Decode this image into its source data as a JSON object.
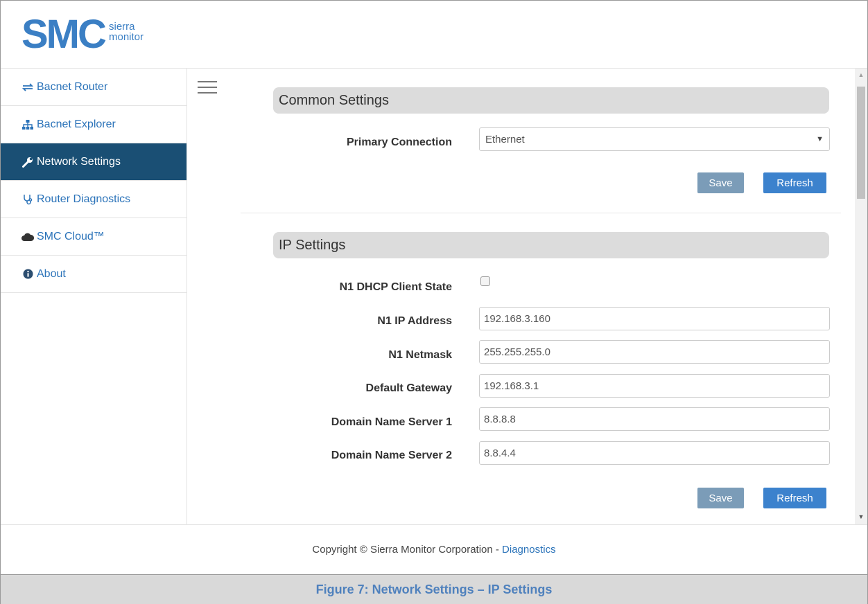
{
  "header": {
    "logo_text": "SMC",
    "logo_sub_line1": "sierra",
    "logo_sub_line2": "monitor"
  },
  "sidebar": {
    "items": [
      {
        "label": "Bacnet Router",
        "icon": "exchange-arrows-icon",
        "active": false
      },
      {
        "label": "Bacnet Explorer",
        "icon": "sitemap-icon",
        "active": false
      },
      {
        "label": "Network Settings",
        "icon": "wrench-icon",
        "active": true
      },
      {
        "label": "Router Diagnostics",
        "icon": "stethoscope-icon",
        "active": false
      },
      {
        "label": "SMC Cloud™",
        "icon": "cloud-icon",
        "active": false
      },
      {
        "label": "About",
        "icon": "info-circle-icon",
        "active": false
      }
    ]
  },
  "common_settings": {
    "title": "Common Settings",
    "primary_connection_label": "Primary Connection",
    "primary_connection_value": "Ethernet",
    "save_label": "Save",
    "refresh_label": "Refresh"
  },
  "ip_settings": {
    "title": "IP Settings",
    "dhcp_label": "N1 DHCP Client State",
    "dhcp_checked": false,
    "fields": [
      {
        "label": "N1 IP Address",
        "value": "192.168.3.160"
      },
      {
        "label": "N1 Netmask",
        "value": "255.255.255.0"
      },
      {
        "label": "Default Gateway",
        "value": "192.168.3.1"
      },
      {
        "label": "Domain Name Server 1",
        "value": "8.8.8.8"
      },
      {
        "label": "Domain Name Server 2",
        "value": "8.8.4.4"
      }
    ],
    "save_label": "Save",
    "refresh_label": "Refresh"
  },
  "footer": {
    "copyright": "Copyright © Sierra Monitor Corporation - ",
    "diagnostics_link": "Diagnostics"
  },
  "caption": "Figure 7: Network Settings – IP Settings",
  "colors": {
    "accent": "#3c82cd",
    "nav_active_bg": "#1a4f74",
    "link": "#2b73b9",
    "save_button": "#7b9cb8",
    "caption_text": "#4f81bd"
  }
}
